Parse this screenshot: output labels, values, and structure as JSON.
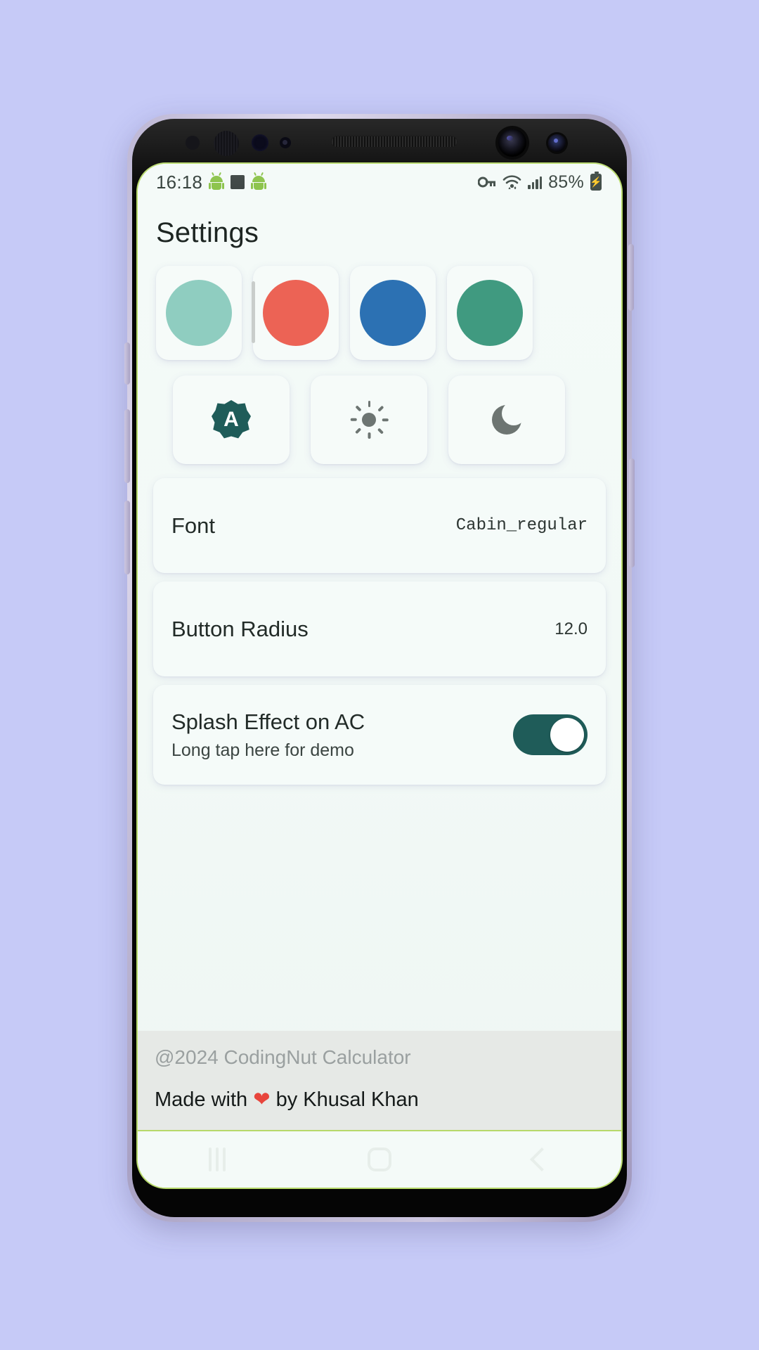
{
  "background_color": "#c6caf7",
  "status_bar": {
    "time": "16:18",
    "battery_percent": "85%",
    "icons": [
      "android-robot-icon",
      "square-icon",
      "android-robot-icon",
      "vpn-key-icon",
      "wifi-icon",
      "signal-bars-icon",
      "battery-charging-icon"
    ]
  },
  "app": {
    "title": "Settings"
  },
  "color_picker": {
    "name": "accent-color-picker",
    "swatches": [
      {
        "name": "mint-teal",
        "color": "#8fcdc0",
        "selected": true
      },
      {
        "name": "coral-red",
        "color": "#ec6355",
        "selected": false
      },
      {
        "name": "steel-blue",
        "color": "#2c71b3",
        "selected": false
      },
      {
        "name": "sea-green",
        "color": "#409a80",
        "selected": false
      }
    ]
  },
  "theme_modes": [
    {
      "name": "auto",
      "icon": "auto-theme-icon",
      "glyph": "A",
      "selected": true,
      "color": "#1f5c59"
    },
    {
      "name": "light",
      "icon": "sun-icon",
      "selected": false,
      "color": "#6d7572"
    },
    {
      "name": "dark",
      "icon": "moon-icon",
      "selected": false,
      "color": "#6d7572"
    }
  ],
  "settings": [
    {
      "name": "font",
      "title": "Font",
      "value": "Cabin_regular",
      "type": "value"
    },
    {
      "name": "button-radius",
      "title": "Button Radius",
      "value": "12.0",
      "type": "value"
    },
    {
      "name": "splash-effect-on-ac",
      "title": "Splash Effect on AC",
      "subtitle": "Long tap here for demo",
      "toggle_on": true,
      "type": "toggle"
    }
  ],
  "footer": {
    "copyright": "@2024 CodingNut Calculator",
    "made_with_prefix": "Made with ",
    "heart": "❤",
    "made_with_suffix": " by Khusal Khan"
  },
  "nav_bar": {
    "recents_label": "recents-button",
    "home_label": "home-button",
    "back_label": "back-button"
  }
}
